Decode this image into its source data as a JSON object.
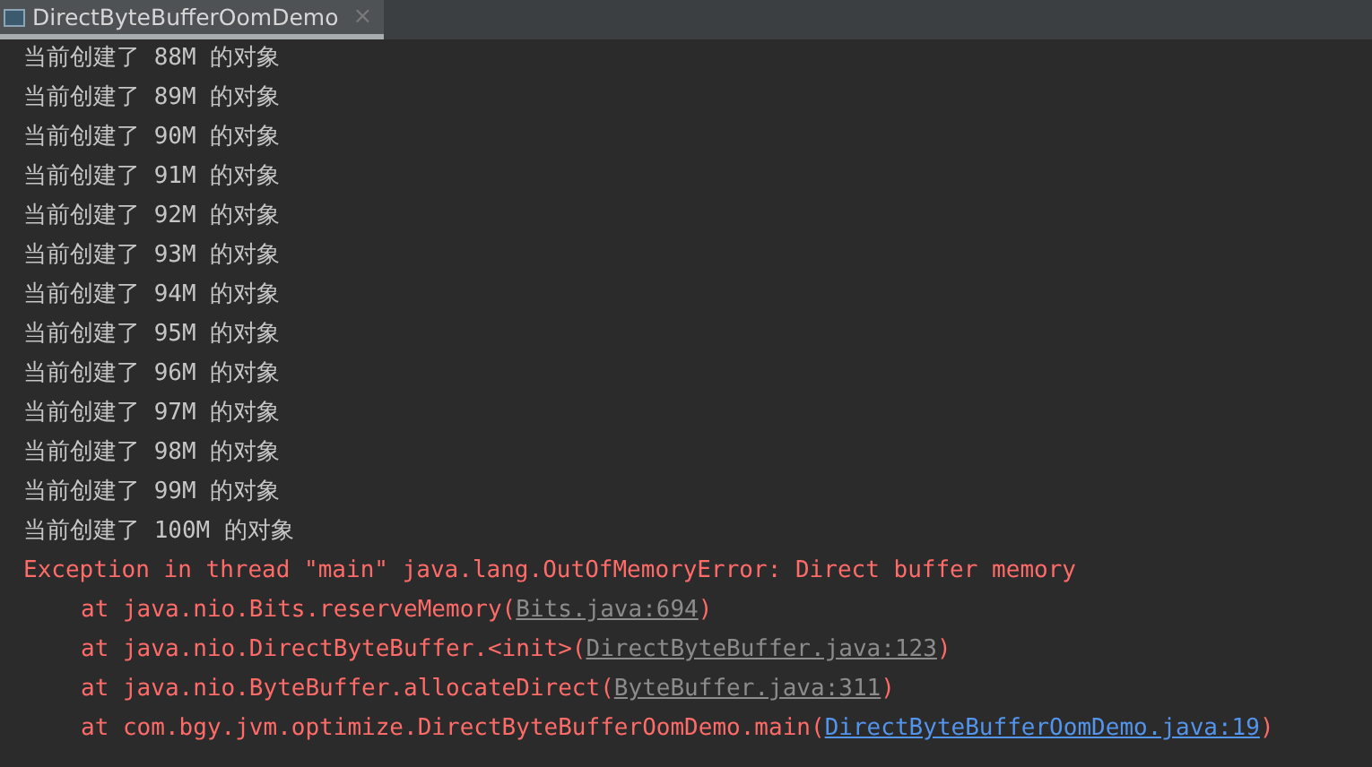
{
  "tab": {
    "title": "DirectByteBufferOomDemo",
    "close": "×",
    "selected": true
  },
  "console": [
    {
      "kind": "output",
      "text": "当前创建了 88M 的对象"
    },
    {
      "kind": "output",
      "text": "当前创建了 89M 的对象"
    },
    {
      "kind": "output",
      "text": "当前创建了 90M 的对象"
    },
    {
      "kind": "output",
      "text": "当前创建了 91M 的对象"
    },
    {
      "kind": "output",
      "text": "当前创建了 92M 的对象"
    },
    {
      "kind": "output",
      "text": "当前创建了 93M 的对象"
    },
    {
      "kind": "output",
      "text": "当前创建了 94M 的对象"
    },
    {
      "kind": "output",
      "text": "当前创建了 95M 的对象"
    },
    {
      "kind": "output",
      "text": "当前创建了 96M 的对象"
    },
    {
      "kind": "output",
      "text": "当前创建了 97M 的对象"
    },
    {
      "kind": "output",
      "text": "当前创建了 98M 的对象"
    },
    {
      "kind": "output",
      "text": "当前创建了 99M 的对象"
    },
    {
      "kind": "output",
      "text": "当前创建了 100M 的对象"
    },
    {
      "kind": "error",
      "text": "Exception in thread \"main\" java.lang.OutOfMemoryError: Direct buffer memory"
    },
    {
      "kind": "trace",
      "text": "at java.nio.Bits.reserveMemory(",
      "link": "Bits.java:694",
      "color": "#8c8c8c",
      "end": ")"
    },
    {
      "kind": "trace",
      "text": "at java.nio.DirectByteBuffer.<init>(",
      "link": "DirectByteBuffer.java:123",
      "color": "#8c8c8c",
      "end": ")"
    },
    {
      "kind": "trace",
      "text": "at java.nio.ByteBuffer.allocateDirect(",
      "link": "ByteBuffer.java:311",
      "color": "#8c8c8c",
      "end": ")"
    },
    {
      "kind": "trace",
      "text": "at com.bgy.jvm.optimize.DirectByteBufferOomDemo.main(",
      "link": "DirectByteBufferOomDemo.java:19",
      "color": "#5394ec",
      "end": ")"
    }
  ]
}
